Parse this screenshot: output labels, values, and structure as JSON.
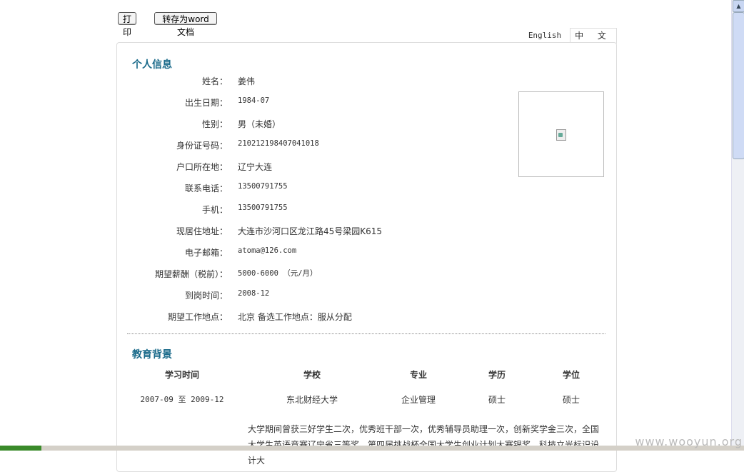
{
  "toolbar": {
    "print_label": "打印",
    "word_label": "转存为word文档"
  },
  "lang_tabs": {
    "english": "English",
    "chinese": "中 文"
  },
  "personal": {
    "title": "个人信息",
    "rows": [
      {
        "label": "姓名：",
        "value": "姜伟"
      },
      {
        "label": "出生日期：",
        "value": "1984-07"
      },
      {
        "label": "性别：",
        "value": "男（未婚）"
      },
      {
        "label": "身份证号码：",
        "value": "210212198407041018"
      },
      {
        "label": "户口所在地：",
        "value": "辽宁大连"
      },
      {
        "label": "联系电话：",
        "value": "13500791755"
      },
      {
        "label": "手机：",
        "value": "13500791755"
      },
      {
        "label": "现居住地址：",
        "value": "大连市沙河口区龙江路45号梁园K615"
      },
      {
        "label": "电子邮箱：",
        "value": "atoma@126.com"
      },
      {
        "label": "期望薪酬（税前）：",
        "value": "5000-6000 （元/月）"
      },
      {
        "label": "到岗时间：",
        "value": "2008-12"
      },
      {
        "label": "期望工作地点：",
        "value": "北京    备选工作地点：服从分配"
      }
    ]
  },
  "education": {
    "title": "教育背景",
    "headers": [
      "学习时间",
      "学校",
      "专业",
      "学历",
      "学位"
    ],
    "row": [
      "2007-09 至 2009-12",
      "东北财经大学",
      "企业管理",
      "硕士",
      "硕士"
    ],
    "remark": "大学期间曾获三好学生二次，优秀班干部一次，优秀辅导员助理一次，创新奖学金三次，全国大学生英语竞赛辽宁省三等奖，第四届挑战杯全国大学生创业计划大赛银奖，科技立光标识设计大"
  },
  "watermark": "www.wooyun.org"
}
